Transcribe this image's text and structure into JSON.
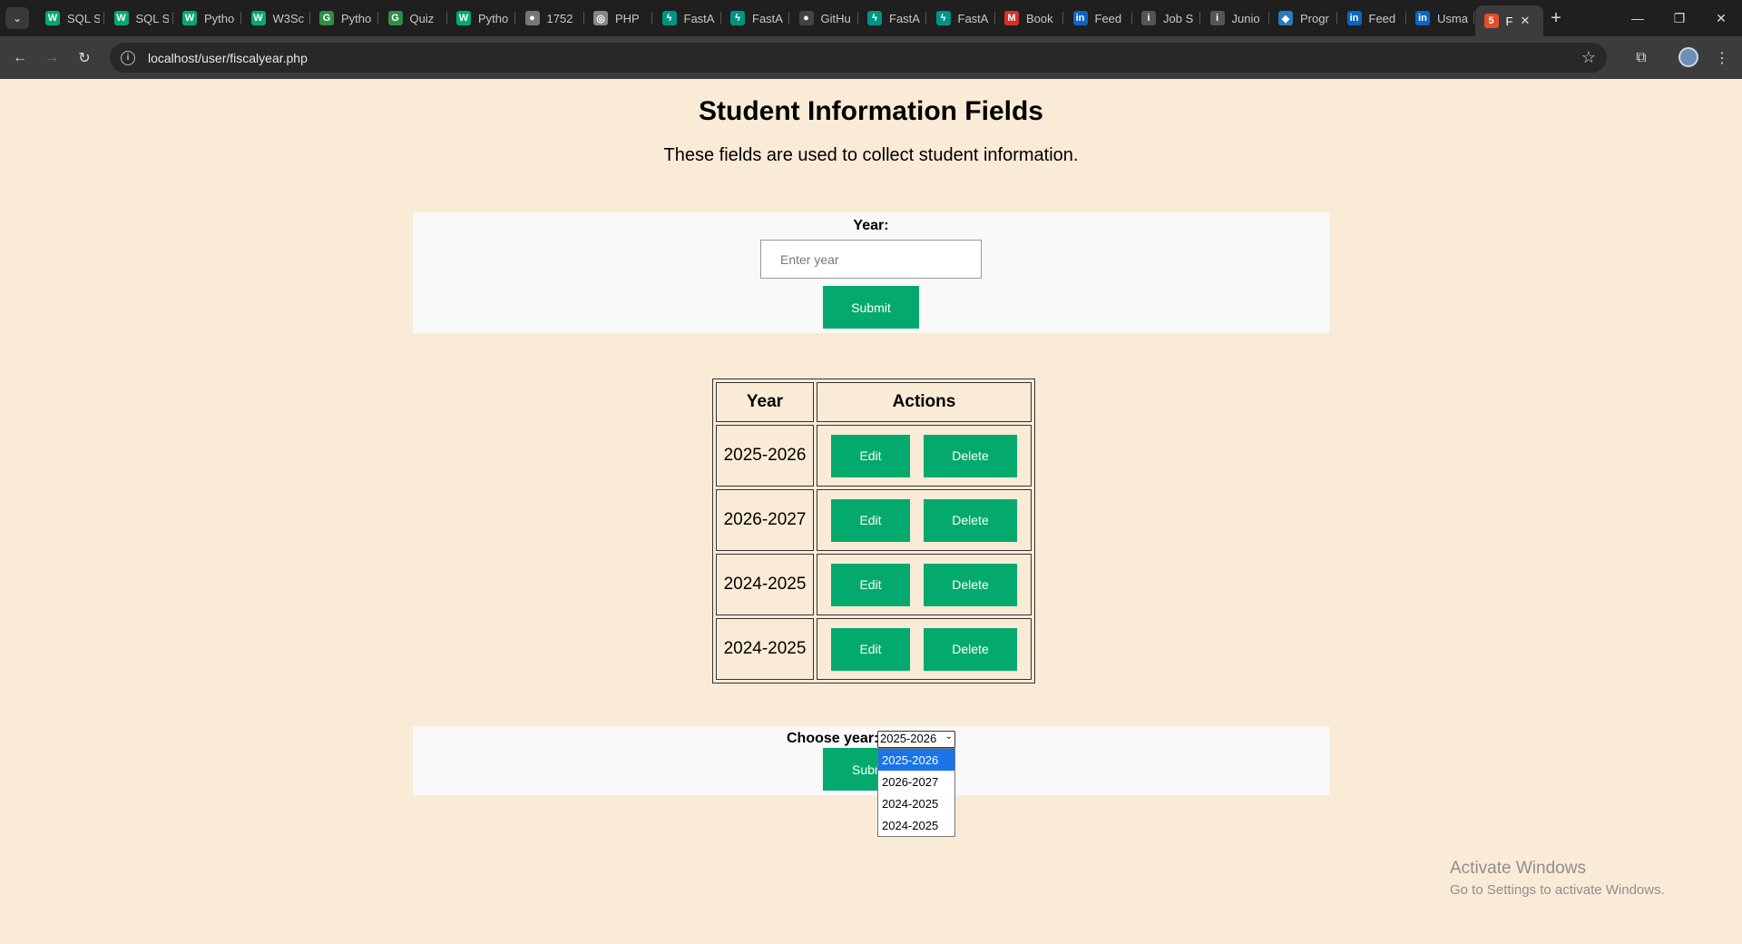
{
  "browser": {
    "tabs": [
      {
        "title": "SQL S",
        "icon": "w3schools-icon",
        "color": "#04aa6d",
        "glyph": "W"
      },
      {
        "title": "SQL S",
        "icon": "w3schools-icon",
        "color": "#04aa6d",
        "glyph": "W"
      },
      {
        "title": "Pytho",
        "icon": "w3schools-icon",
        "color": "#04aa6d",
        "glyph": "W"
      },
      {
        "title": "W3Sc",
        "icon": "w3schools-icon",
        "color": "#04aa6d",
        "glyph": "W"
      },
      {
        "title": "Pytho",
        "icon": "geeksforgeeks-icon",
        "color": "#2f8d46",
        "glyph": "G"
      },
      {
        "title": "Quiz",
        "icon": "geeksforgeeks-icon",
        "color": "#2f8d46",
        "glyph": "G"
      },
      {
        "title": "Pytho",
        "icon": "w3schools-icon",
        "color": "#04aa6d",
        "glyph": "W"
      },
      {
        "title": "1752",
        "icon": "globe-icon",
        "color": "#777777",
        "glyph": "●"
      },
      {
        "title": "PHP",
        "icon": "globe-icon",
        "color": "#888888",
        "glyph": "◎"
      },
      {
        "title": "FastA",
        "icon": "fastapi-icon",
        "color": "#009485",
        "glyph": "ϟ"
      },
      {
        "title": "FastA",
        "icon": "fastapi-icon",
        "color": "#009485",
        "glyph": "ϟ"
      },
      {
        "title": "GitHu",
        "icon": "github-icon",
        "color": "#444444",
        "glyph": "●"
      },
      {
        "title": "FastA",
        "icon": "fastapi-icon",
        "color": "#009485",
        "glyph": "ϟ"
      },
      {
        "title": "FastA",
        "icon": "fastapi-icon",
        "color": "#009485",
        "glyph": "ϟ"
      },
      {
        "title": "Book",
        "icon": "gmail-icon",
        "color": "#d93025",
        "glyph": "M"
      },
      {
        "title": "Feed",
        "icon": "linkedin-icon",
        "color": "#0a66c2",
        "glyph": "in"
      },
      {
        "title": "Job S",
        "icon": "info-icon",
        "color": "#555555",
        "glyph": "i"
      },
      {
        "title": "Junio",
        "icon": "info-icon",
        "color": "#555555",
        "glyph": "i"
      },
      {
        "title": "Progr",
        "icon": "shield-icon",
        "color": "#2a7bbf",
        "glyph": "◆"
      },
      {
        "title": "Feed",
        "icon": "linkedin-icon",
        "color": "#0a66c2",
        "glyph": "in"
      },
      {
        "title": "Usma",
        "icon": "linkedin-icon",
        "color": "#0a66c2",
        "glyph": "in"
      },
      {
        "title": "F",
        "icon": "html5-icon",
        "color": "#e44d26",
        "glyph": "5"
      }
    ],
    "url": "localhost/user/fiscalyear.php"
  },
  "page": {
    "title": "Student Information Fields",
    "subtitle": "These fields are used to collect student information."
  },
  "form": {
    "year_label": "Year:",
    "year_placeholder": "Enter year",
    "submit_label": "Submit"
  },
  "table": {
    "headers": [
      "Year",
      "Actions"
    ],
    "edit_label": "Edit",
    "delete_label": "Delete",
    "rows": [
      {
        "year": "2025-2026"
      },
      {
        "year": "2026-2027"
      },
      {
        "year": "2024-2025"
      },
      {
        "year": "2024-2025"
      }
    ]
  },
  "choose": {
    "label": "Choose year:",
    "selected": "2025-2026",
    "options": [
      "2025-2026",
      "2026-2027",
      "2024-2025",
      "2024-2025"
    ],
    "submit_label": "Submit",
    "submit_visible_text": "Subm"
  },
  "watermark": {
    "line1": "Activate Windows",
    "line2": "Go to Settings to activate Windows."
  },
  "colors": {
    "page_bg": "#faebd7",
    "button_green": "#04aa6d",
    "panel_bg": "#f9f9f9"
  }
}
